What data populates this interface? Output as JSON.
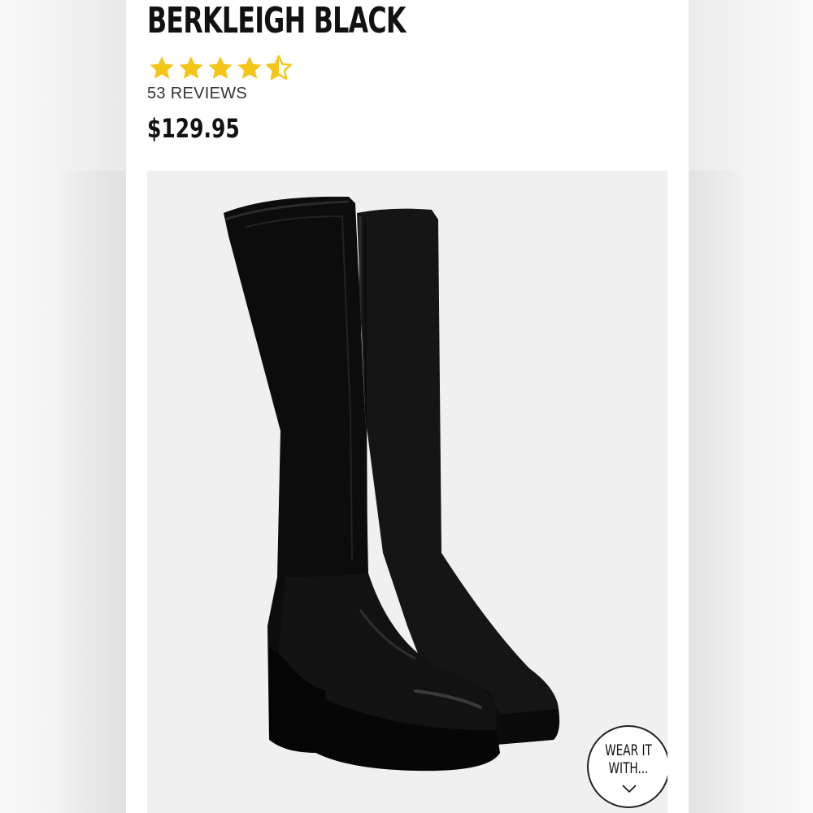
{
  "product": {
    "title": "BERKLEIGH BLACK",
    "rating": 4.5,
    "rating_max": 5,
    "reviews_label": "53 REVIEWS",
    "price": "$129.95"
  },
  "wear_it_with": {
    "line1": "WEAR IT",
    "line2": "WITH...",
    "icon": "chevron-down-icon"
  },
  "colors": {
    "star": "#f5c518",
    "text": "#111111",
    "image_bg": "#f0f0f0"
  }
}
